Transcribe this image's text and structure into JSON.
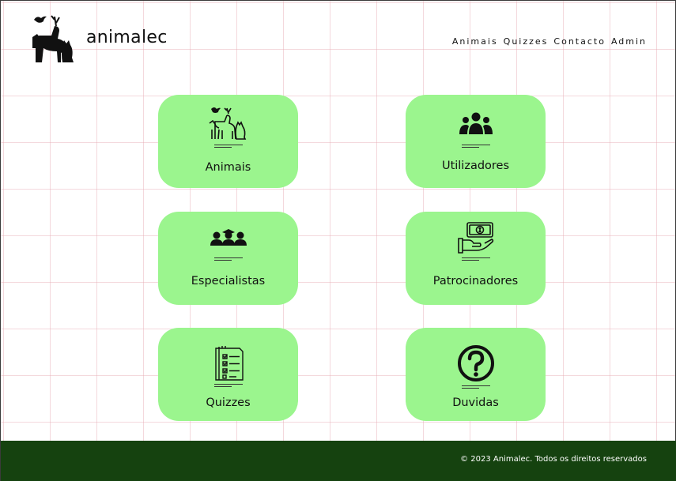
{
  "header": {
    "brand": "animalec",
    "logo_icon": "deer-cat-dog-bird-logo-icon",
    "nav": [
      "Animais",
      "Quizzes",
      "Contacto",
      "Admin"
    ]
  },
  "cards": [
    {
      "label": "Animais",
      "icon": "animals-icon"
    },
    {
      "label": "Utilizadores",
      "icon": "users-group-icon"
    },
    {
      "label": "Especialistas",
      "icon": "specialists-icon"
    },
    {
      "label": "Patrocinadores",
      "icon": "money-hand-icon"
    },
    {
      "label": "Quizzes",
      "icon": "checklist-icon"
    },
    {
      "label": "Duvidas",
      "icon": "question-icon"
    }
  ],
  "footer": {
    "copyright": "© 2023 Animalec. Todos os direitos reservados"
  },
  "colors": {
    "card_bg": "#9bf58e",
    "footer_bg": "#15420f",
    "grid_line": "#e6aab4"
  }
}
